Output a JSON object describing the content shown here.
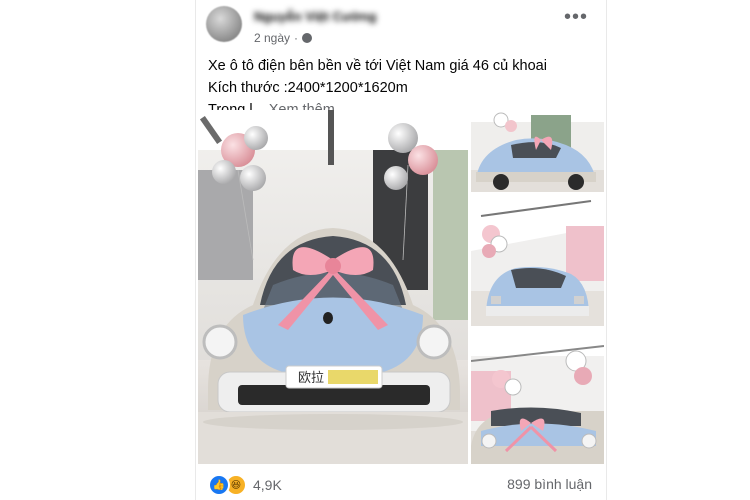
{
  "post": {
    "author": "Nguyễn Việt Cường",
    "time": "2 ngày",
    "privacy_icon": "globe-icon",
    "more_icon": "more-horizontal-icon",
    "caption": {
      "line1": "Xe ô tô điện bên bền về tới Việt Nam giá 46 củ khoai",
      "line2": "Kích thước :2400*1200*1620m",
      "line3": "Trọng l...",
      "see_more": "Xem thêm"
    },
    "photo_badge": "欧拉",
    "reactions": {
      "icons": [
        "like-icon",
        "haha-icon"
      ],
      "count": "4,9K"
    },
    "comments": "899 bình luận"
  },
  "colors": {
    "car_body": "#a9c4e4",
    "bow": "#f4a6b6",
    "fb_blue": "#1877f2",
    "meta_gray": "#65676b"
  }
}
